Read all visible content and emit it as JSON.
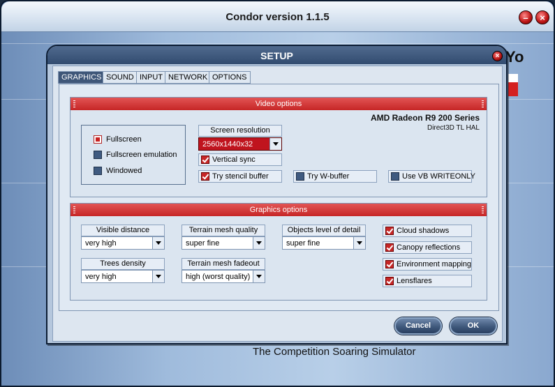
{
  "window": {
    "title": "Condor version 1.1.5",
    "logo_fragment": "Yo",
    "tagline": "The Competition Soaring Simulator"
  },
  "dialog": {
    "title": "SETUP"
  },
  "tabs": [
    {
      "label": "GRAPHICS",
      "active": true
    },
    {
      "label": "SOUND",
      "active": false
    },
    {
      "label": "INPUT",
      "active": false
    },
    {
      "label": "NETWORK",
      "active": false
    },
    {
      "label": "OPTIONS",
      "active": false
    }
  ],
  "video": {
    "header": "Video options",
    "display_modes": [
      {
        "label": "Fullscreen",
        "selected": true
      },
      {
        "label": "Fullscreen emulation",
        "selected": false
      },
      {
        "label": "Windowed",
        "selected": false
      }
    ],
    "resolution_label": "Screen resolution",
    "resolution_value": "2560x1440x32",
    "vertical_sync": {
      "label": "Vertical sync",
      "checked": true
    },
    "stencil": {
      "label": "Try stencil buffer",
      "checked": true
    },
    "wbuffer": {
      "label": "Try W-buffer",
      "checked": false
    },
    "vb": {
      "label": "Use VB WRITEONLY",
      "checked": false
    },
    "gpu_name": "AMD Radeon R9 200 Series",
    "gpu_api": "Direct3D TL HAL"
  },
  "graphics": {
    "header": "Graphics options",
    "visible_distance": {
      "label": "Visible distance",
      "value": "very high"
    },
    "terrain_mesh_quality": {
      "label": "Terrain mesh quality",
      "value": "super fine"
    },
    "objects_lod": {
      "label": "Objects level of detail",
      "value": "super fine"
    },
    "trees_density": {
      "label": "Trees density",
      "value": "very high"
    },
    "terrain_mesh_fadeout": {
      "label": "Terrain mesh fadeout",
      "value": "high (worst quality)"
    },
    "cloud_shadows": {
      "label": "Cloud shadows",
      "checked": true
    },
    "canopy_reflections": {
      "label": "Canopy reflections",
      "checked": true
    },
    "environment_mapping": {
      "label": "Environment mapping",
      "checked": true
    },
    "lensflares": {
      "label": "Lensflares",
      "checked": true
    }
  },
  "buttons": {
    "cancel": "Cancel",
    "ok": "OK"
  },
  "colors": {
    "accent_red": "#c62626",
    "panel_blue": "#dbe5f0",
    "title_blue": "#324c70"
  }
}
